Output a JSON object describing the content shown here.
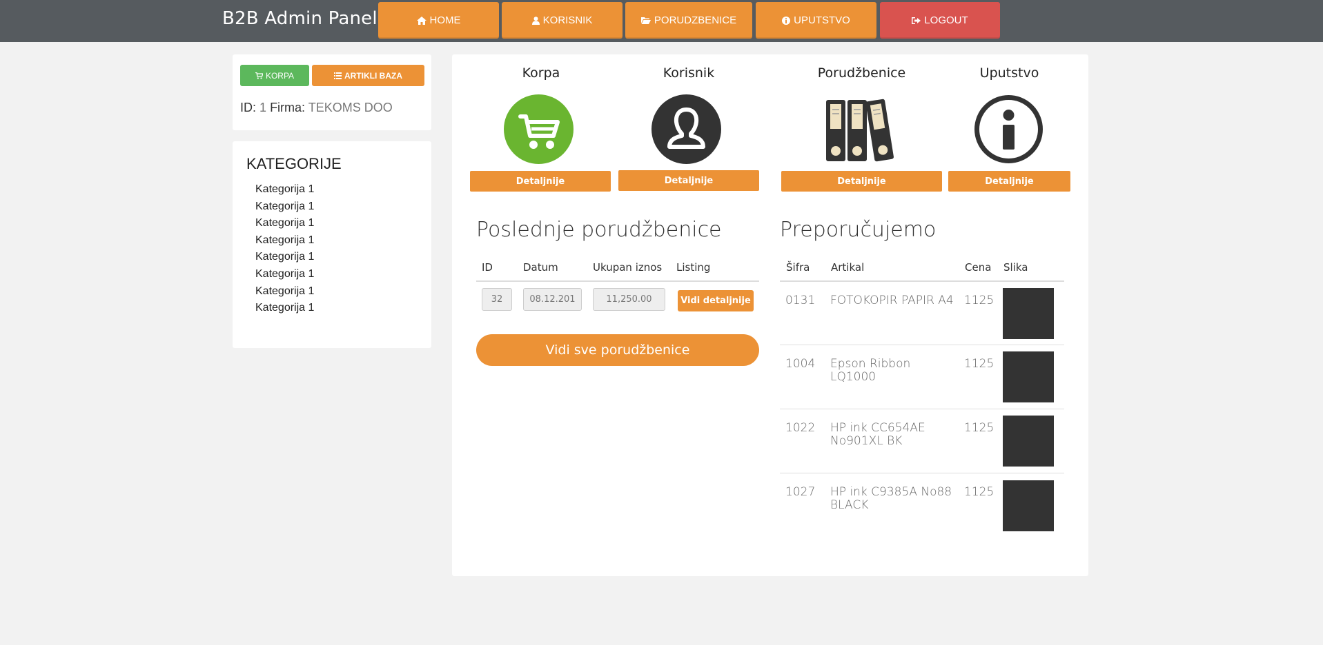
{
  "header": {
    "brand": "B2B Admin Panel",
    "nav": {
      "home": "HOME",
      "korisnik": "KORISNIK",
      "porudzbenice": "PORUDZBENICE",
      "uputstvo": "UPUTSTVO",
      "logout": "LOGOUT"
    },
    "colors": {
      "bar": "#565b5f",
      "accent": "#ec9236",
      "danger": "#d9534f"
    }
  },
  "left_panel": {
    "korpa_label": "KORPA",
    "artikli_label": "ARTIKLI BAZA",
    "id_label": "ID:",
    "id_value": "1",
    "firma_label": "Firma:",
    "firma_value": "TEKOMS DOO",
    "korpa_color": "#5cb85c"
  },
  "categories": {
    "title": "KATEGORIJE",
    "items": [
      "Kategorija  1",
      "Kategorija  1",
      "Kategorija  1",
      "Kategorija  1",
      "Kategorija  1",
      "Kategorija  1",
      "Kategorija  1",
      "Kategorija  1"
    ]
  },
  "tiles": [
    {
      "title": "Korpa",
      "button": "Detaljnije",
      "icon": "cart-icon",
      "color": "#6ab530"
    },
    {
      "title": "Korisnik",
      "button": "Detaljnije",
      "icon": "user-icon",
      "color": "#333333"
    },
    {
      "title": "Porudžbenice",
      "button": "Detaljnije",
      "icon": "binders-icon",
      "color": "#333333"
    },
    {
      "title": "Uputstvo",
      "button": "Detaljnije",
      "icon": "info-icon",
      "color": "#333333"
    }
  ],
  "orders": {
    "title": "Poslednje porudžbenice",
    "columns": [
      "ID",
      "Datum",
      "Ukupan iznos",
      "Listing"
    ],
    "rows": [
      {
        "id": "32",
        "datum": "08.12.201",
        "iznos": "11,250.00",
        "action": "Vidi detaljnije"
      }
    ],
    "view_all": "Vidi sve porudžbenice"
  },
  "recommended": {
    "title": "Preporučujemo",
    "columns": [
      "Šifra",
      "Artikal",
      "Cena",
      "Slika"
    ],
    "rows": [
      {
        "sifra": "0131",
        "artikal": "FOTOKOPIR PAPIR A4",
        "cena": "1125"
      },
      {
        "sifra": "1004",
        "artikal": "Epson Ribbon LQ1000",
        "cena": "1125"
      },
      {
        "sifra": "1022",
        "artikal": "HP ink CC654AE No901XL BK",
        "cena": "1125"
      },
      {
        "sifra": "1027",
        "artikal": "HP ink C9385A No88 BLACK",
        "cena": "1125"
      }
    ]
  }
}
